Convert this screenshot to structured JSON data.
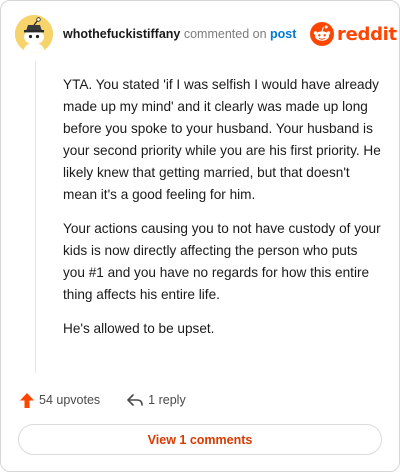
{
  "header": {
    "username": "whothefuckistiffany",
    "action_text": "commented on",
    "post_link": "post"
  },
  "brand": {
    "wordmark": "reddit",
    "icon": "reddit-alien-icon",
    "color": "#ff4500"
  },
  "avatar": {
    "icon": "snoo-avatar-icon",
    "background": "#f6d36b"
  },
  "comment": {
    "paragraphs": [
      "YTA. You stated 'if I was selfish I would have already made up my mind' and it clearly was made up long before you spoke to your husband. Your husband is your second priority while you are his first priority. He likely knew that getting married, but that doesn't mean it's a good feeling for him.",
      "Your actions causing you to not have custody of your kids is now directly affecting the person who puts you #1 and you have no regards for how this entire thing affects his entire life.",
      "He's allowed to be upset."
    ]
  },
  "actions": {
    "upvotes_label": "54 upvotes",
    "upvote_icon": "upvote-arrow-icon",
    "upvote_color": "#ff4500",
    "replies_label": "1 reply",
    "reply_icon": "reply-arrow-icon"
  },
  "footer": {
    "view_comments_label": "View 1 comments",
    "accent": "#d93a00"
  }
}
